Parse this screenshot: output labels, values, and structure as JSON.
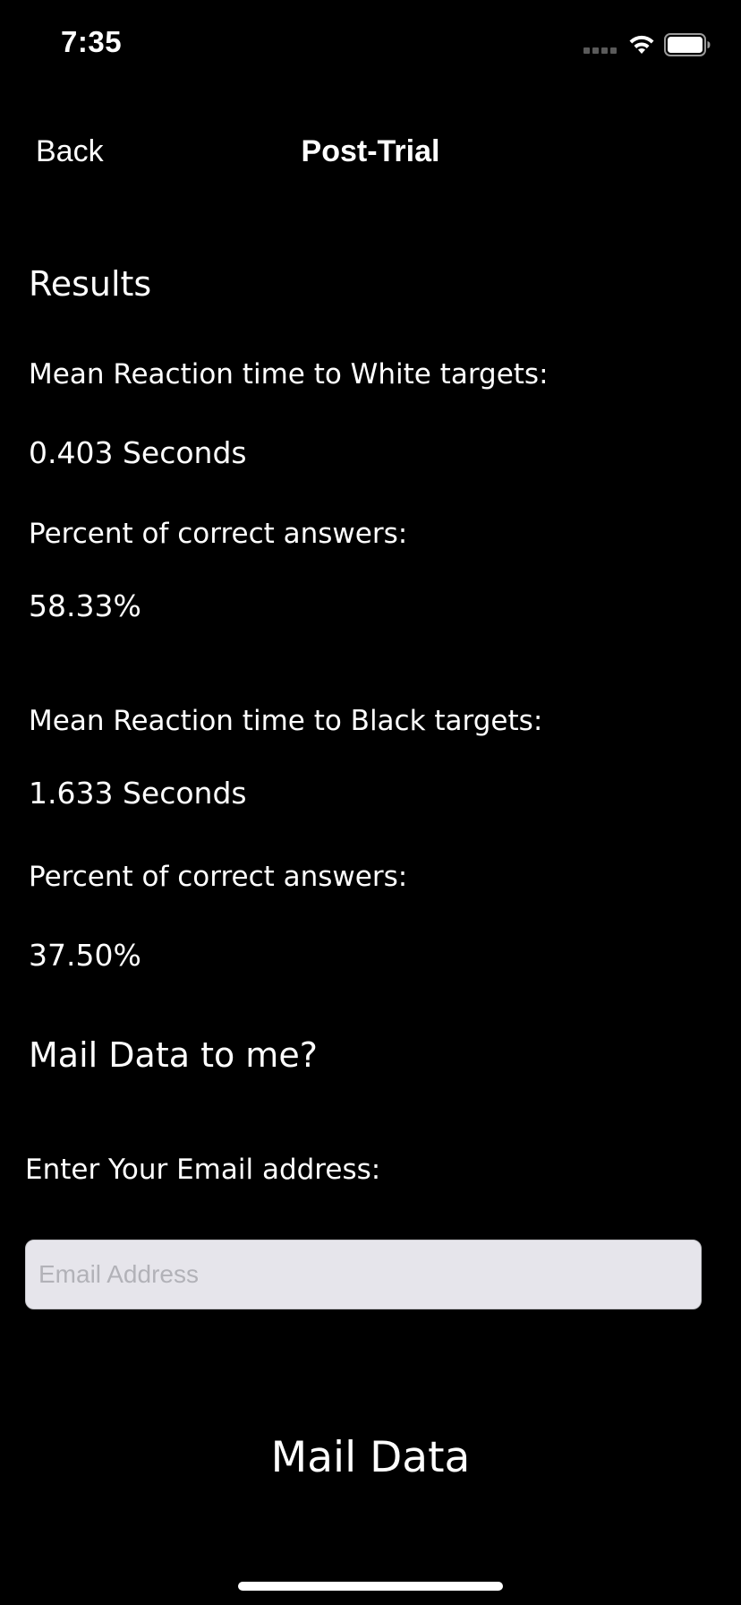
{
  "status_bar": {
    "time": "7:35",
    "icons": [
      "signal-icon",
      "wifi-icon",
      "battery-icon"
    ]
  },
  "nav": {
    "back_label": "Back",
    "title": "Post-Trial"
  },
  "results": {
    "heading": "Results",
    "white": {
      "label": "Mean Reaction time to White targets:",
      "time": "0.403 Seconds",
      "percent_label": "Percent of correct answers:",
      "percent": "58.33%"
    },
    "black": {
      "label": "Mean Reaction time to Black targets:",
      "time": "1.633 Seconds",
      "percent_label": "Percent of correct answers:",
      "percent": "37.50%"
    }
  },
  "mail": {
    "heading": "Mail Data to me?",
    "email_label": "Enter Your Email address:",
    "email_value": "",
    "email_placeholder": "Email Address",
    "button_label": "Mail Data"
  },
  "colors": {
    "background": "#000000",
    "text": "#ffffff",
    "input_background": "#e6e5eb",
    "placeholder": "#b2b2b8"
  }
}
